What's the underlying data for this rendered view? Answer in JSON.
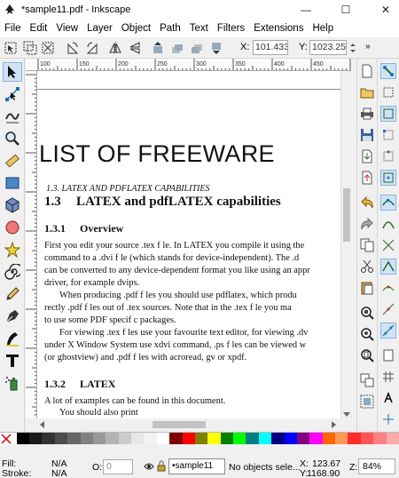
{
  "window": {
    "title": "*sample11.pdf - Inkscape",
    "minimize": "—",
    "maximize": "☐",
    "close": "✕"
  },
  "menu": [
    "File",
    "Edit",
    "View",
    "Layer",
    "Object",
    "Path",
    "Text",
    "Filters",
    "Extensions",
    "Help"
  ],
  "toolbar": {
    "x_label": "X:",
    "x_value": "101.433",
    "y_label": "Y:",
    "y_value": "1023.25"
  },
  "ruler": {
    "tick_labels": [
      "100",
      "150",
      "200",
      "250",
      "300",
      "350",
      "400",
      "450"
    ]
  },
  "document": {
    "heading": "LIST OF FREEWARE",
    "running_head": "1.3.   LATEX AND PDFLATEX CAPABILITIES",
    "section_number": "1.3",
    "section_title": "LATEX and pdfLATEX capabilities",
    "subsection_1_number": "1.3.1",
    "subsection_1_title": "Overview",
    "p1_l1": "First you edit your source .tex f le. In LATEX you compile it using the",
    "p1_l2": "command to a .dvi f le (which stands for device-independent). The .d",
    "p1_l3": "can be converted to any device-dependent format you like using an appr",
    "p1_l4": "driver, for example dvips.",
    "p2_l1": "When producing .pdf f les you should use pdflatex, which produ",
    "p2_l2": "rectly .pdf f les out of .tex sources. Note that in the .tex f le you ma",
    "p2_l3": "to use some PDF specif c packages.",
    "p3_l1": "For viewing .tex f les use your favourite text editor, for viewing .dv",
    "p3_l2": "under X Window System use xdvi command, .ps f les can be viewed w",
    "p3_l3": "(or ghostview) and .pdf f les with acroread, gv or xpdf.",
    "subsection_2_number": "1.3.2",
    "subsection_2_title": "LATEX",
    "p4_l1": "A lot of examples can be found in this document.",
    "p4_l2": "You should also print"
  },
  "status": {
    "fill_label": "Fill:",
    "fill_value": "N/A",
    "stroke_label": "Stroke:",
    "stroke_value": "N/A",
    "opacity_label": "O:",
    "opacity_value": "0",
    "layer": "•sample11",
    "message": "No objects sele...",
    "x_label": "X:",
    "x_value": "123.67",
    "y_label": "Y:",
    "y_value": "1168.90",
    "zoom_label": "Z:",
    "zoom_value": "84%"
  },
  "palette": [
    "#000000",
    "#1a1a1a",
    "#333333",
    "#4d4d4d",
    "#666666",
    "#808080",
    "#999999",
    "#b3b3b3",
    "#cccccc",
    "#e6e6e6",
    "#f2f2f2",
    "#ffffff",
    "#800000",
    "#ff0000",
    "#808000",
    "#ffff00",
    "#008000",
    "#00ff00",
    "#008080",
    "#00ffff",
    "#000080",
    "#0000ff",
    "#800080",
    "#ff00ff",
    "#ff6600",
    "#ff9955",
    "#ff2a2a",
    "#ff5555",
    "#ff8080",
    "#ffaaaa"
  ]
}
